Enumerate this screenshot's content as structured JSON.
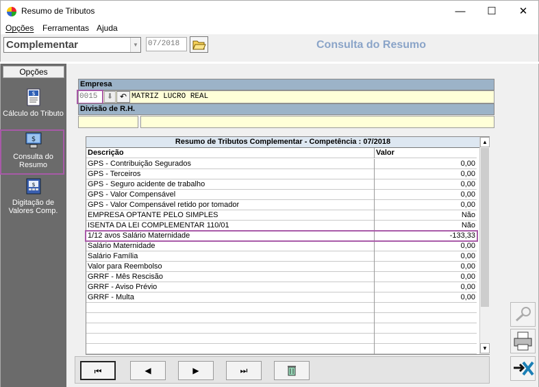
{
  "window": {
    "title": "Resumo de Tributos",
    "minimize_icon": "minimize-icon",
    "maximize_icon": "maximize-icon",
    "close_icon": "close-icon"
  },
  "menu": {
    "items": [
      {
        "label": "Opções",
        "underline_char": "O"
      },
      {
        "label": "Ferramentas",
        "underline_char": "F"
      },
      {
        "label": "Ajuda",
        "underline_char": "A"
      }
    ]
  },
  "toolbar": {
    "type_select_value": "Complementar",
    "period_value": "07/2018",
    "header_title": "Consulta do Resumo"
  },
  "sidebar": {
    "header": "Opções",
    "items": [
      {
        "label": "Cálculo do Tributo",
        "icon": "document-dollar-icon"
      },
      {
        "label": "Consulta do Resumo",
        "icon": "computer-dollar-icon"
      },
      {
        "label": "Digitação de Valores Comp.",
        "icon": "register-dollar-icon"
      }
    ]
  },
  "company": {
    "section_label": "Empresa",
    "code": "0015",
    "name": "MATRIZ LUCRO REAL",
    "division_label": "Divisão de R.H.",
    "division_code": "",
    "division_name": ""
  },
  "grid": {
    "caption": "Resumo de Tributos Complementar - Competência : 07/2018",
    "columns": [
      "Descrição",
      "Valor"
    ],
    "rows": [
      [
        "GPS - Contribuição Segurados",
        "0,00"
      ],
      [
        "GPS - Terceiros",
        "0,00"
      ],
      [
        "GPS - Seguro acidente de trabalho",
        "0,00"
      ],
      [
        "GPS - Valor Compensável",
        "0,00"
      ],
      [
        "GPS - Valor Compensável retido por tomador",
        "0,00"
      ],
      [
        "EMPRESA OPTANTE PELO SIMPLES",
        "Não"
      ],
      [
        "ISENTA DA LEI COMPLEMENTAR 110/01",
        "Não"
      ],
      [
        "1/12 avos Salário Maternidade",
        "-133,33"
      ],
      [
        "Salário Maternidade",
        "0,00"
      ],
      [
        "Salário Família",
        "0,00"
      ],
      [
        "Valor para Reembolso",
        "0,00"
      ],
      [
        "GRRF - Mês Rescisão",
        "0,00"
      ],
      [
        "GRRF - Aviso Prévio",
        "0,00"
      ],
      [
        "GRRF - Multa",
        "0,00"
      ],
      [
        "",
        ""
      ],
      [
        "",
        ""
      ],
      [
        "",
        ""
      ],
      [
        "",
        ""
      ],
      [
        "",
        ""
      ]
    ]
  },
  "nav": {
    "first": "⏮",
    "prev": "◀",
    "next": "▶",
    "last": "⏭"
  },
  "colors": {
    "highlight": "#a85aa8",
    "section": "#9cb3c8",
    "title_accent": "#8aa4c8"
  }
}
